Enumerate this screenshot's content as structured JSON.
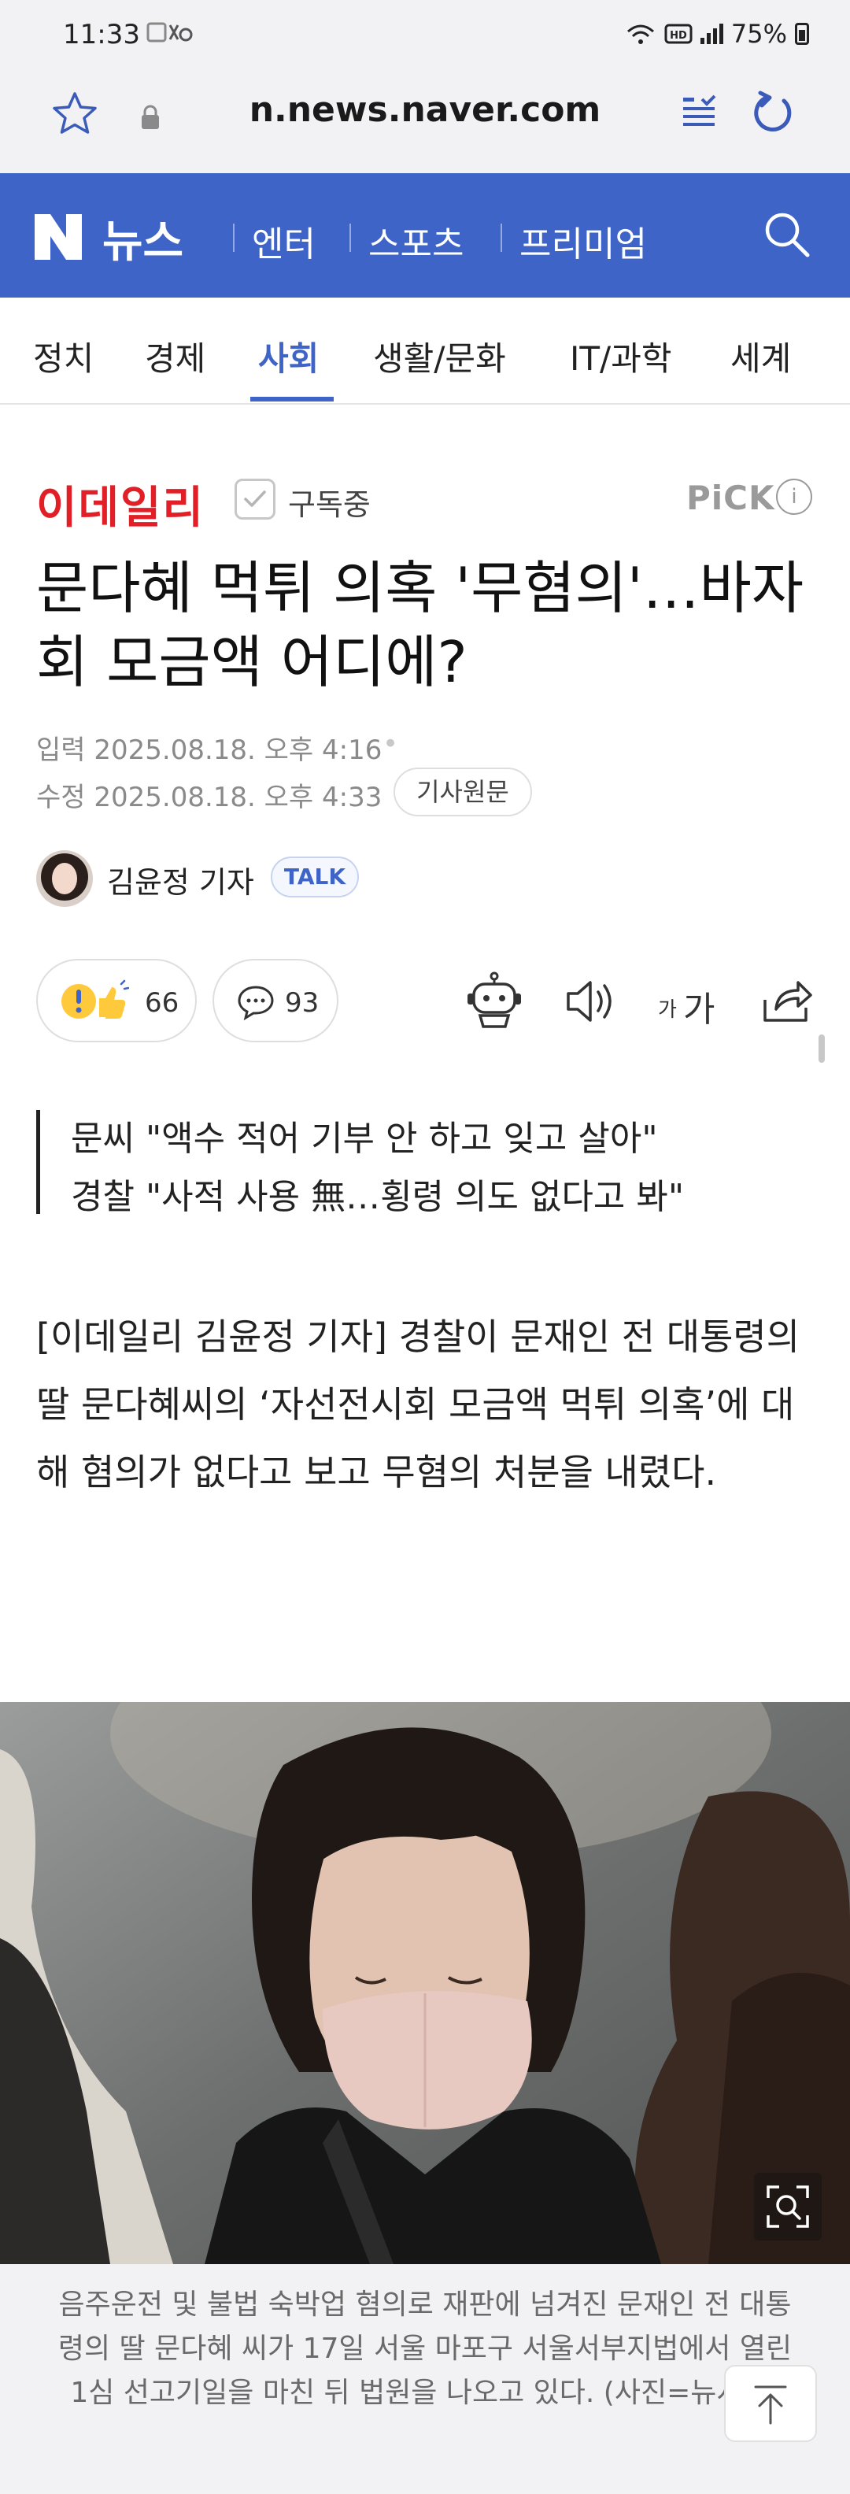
{
  "status_bar": {
    "time": "11:33",
    "battery": "75%",
    "icons": [
      "mute-icon",
      "wifi-icon",
      "hd-icon",
      "signal-icon",
      "battery-icon"
    ]
  },
  "browser": {
    "url": "n.news.naver.com"
  },
  "naver": {
    "logo": "N",
    "title": "뉴스",
    "nav_links": [
      "엔터",
      "스포츠",
      "프리미엄"
    ],
    "brand_color": "#3e64c8"
  },
  "tabs": [
    {
      "label": "정치",
      "active": false
    },
    {
      "label": "경제",
      "active": false
    },
    {
      "label": "사회",
      "active": true
    },
    {
      "label": "생활/문화",
      "active": false
    },
    {
      "label": "IT/과학",
      "active": false
    },
    {
      "label": "세계",
      "active": false
    }
  ],
  "article": {
    "press": "이데일리",
    "press_color": "#e21f26",
    "subscribe_label": "구독중",
    "pick_label": "PiCK",
    "pick_info": "i",
    "headline": "문다혜 먹튀 의혹 '무혐의'…바자회 모금액 어디에?",
    "input_date": "입력 2025.08.18. 오후 4:16",
    "modified_date": "수정 2025.08.18. 오후 4:33",
    "original_button": "기사원문",
    "reporter": "김윤정 기자",
    "talk_label": "TALK",
    "reaction_count": "66",
    "comment_count": "93",
    "font_button_small": "가",
    "font_button_large": "가",
    "summary": [
      "문씨 \"액수 적어 기부 안 하고 잊고 살아\"",
      "경찰 \"사적 사용 無…횡령 의도 없다고 봐\""
    ],
    "body": "[이데일리 김윤정 기자] 경찰이 문재인 전 대통령의 딸 문다혜씨의 ‘자선전시회 모금액 먹튀 의혹’에 대해 혐의가 없다고 보고 무혐의 처분을 내렸다.",
    "photo_caption": "음주운전 및 불법 숙박업 혐의로 재판에 넘겨진 문재인 전 대통령의 딸 문다혜 씨가 17일 서울 마포구 서울서부지법에서 열린 1심 선고기일을 마친 뒤 법원을 나오고 있다. (사진=뉴시스)"
  }
}
